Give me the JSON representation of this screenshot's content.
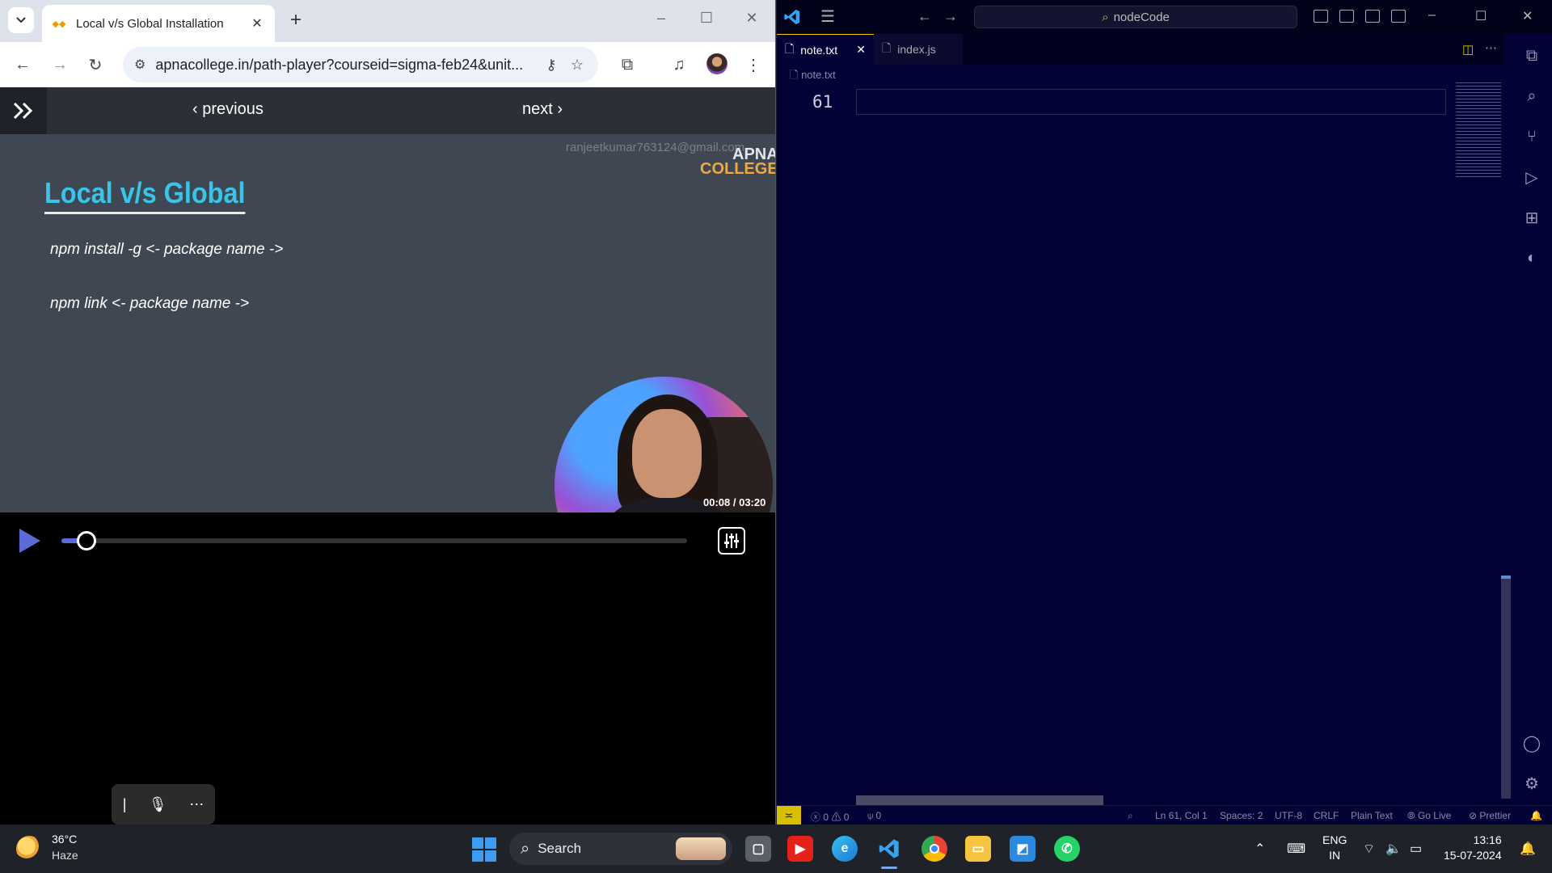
{
  "chrome": {
    "tab_title": "Local v/s Global Installation",
    "address": "apnacollege.in/path-player?courseid=sigma-feb24&unit...",
    "new_tab": "+",
    "tab_close": "✕"
  },
  "player": {
    "previous_label": "‹ previous",
    "next_label": "next ›",
    "watermark": "ranjeetkumar763124@gmail.com",
    "brand_line1": "APNA",
    "brand_line2": "COLLEGE",
    "slide_title": "Local v/s Global",
    "slide_lines": [
      "npm install -g <- package name ->",
      "npm link <- package name ->"
    ],
    "time": "00:08 / 03:20",
    "progress": 0.04
  },
  "vscode": {
    "search_text": "nodeCode",
    "tabs": [
      {
        "label": "note.txt",
        "close": "✕"
      },
      {
        "label": "index.js"
      }
    ],
    "breadcrumb": "note.txt",
    "line_number": "61",
    "status": {
      "errors": "0",
      "warnings": "0",
      "ports": "0",
      "position": "Ln 61, Col 1",
      "spaces": "Spaces: 2",
      "encoding": "UTF-8",
      "eol": "CRLF",
      "language": "Plain Text",
      "golive": "Go Live",
      "prettier": "Prettier"
    }
  },
  "taskbar": {
    "temperature": "36°C",
    "weather": "Haze",
    "search_label": "Search",
    "lang1": "ENG",
    "lang2": "IN",
    "time": "13:16",
    "date": "15-07-2024"
  }
}
